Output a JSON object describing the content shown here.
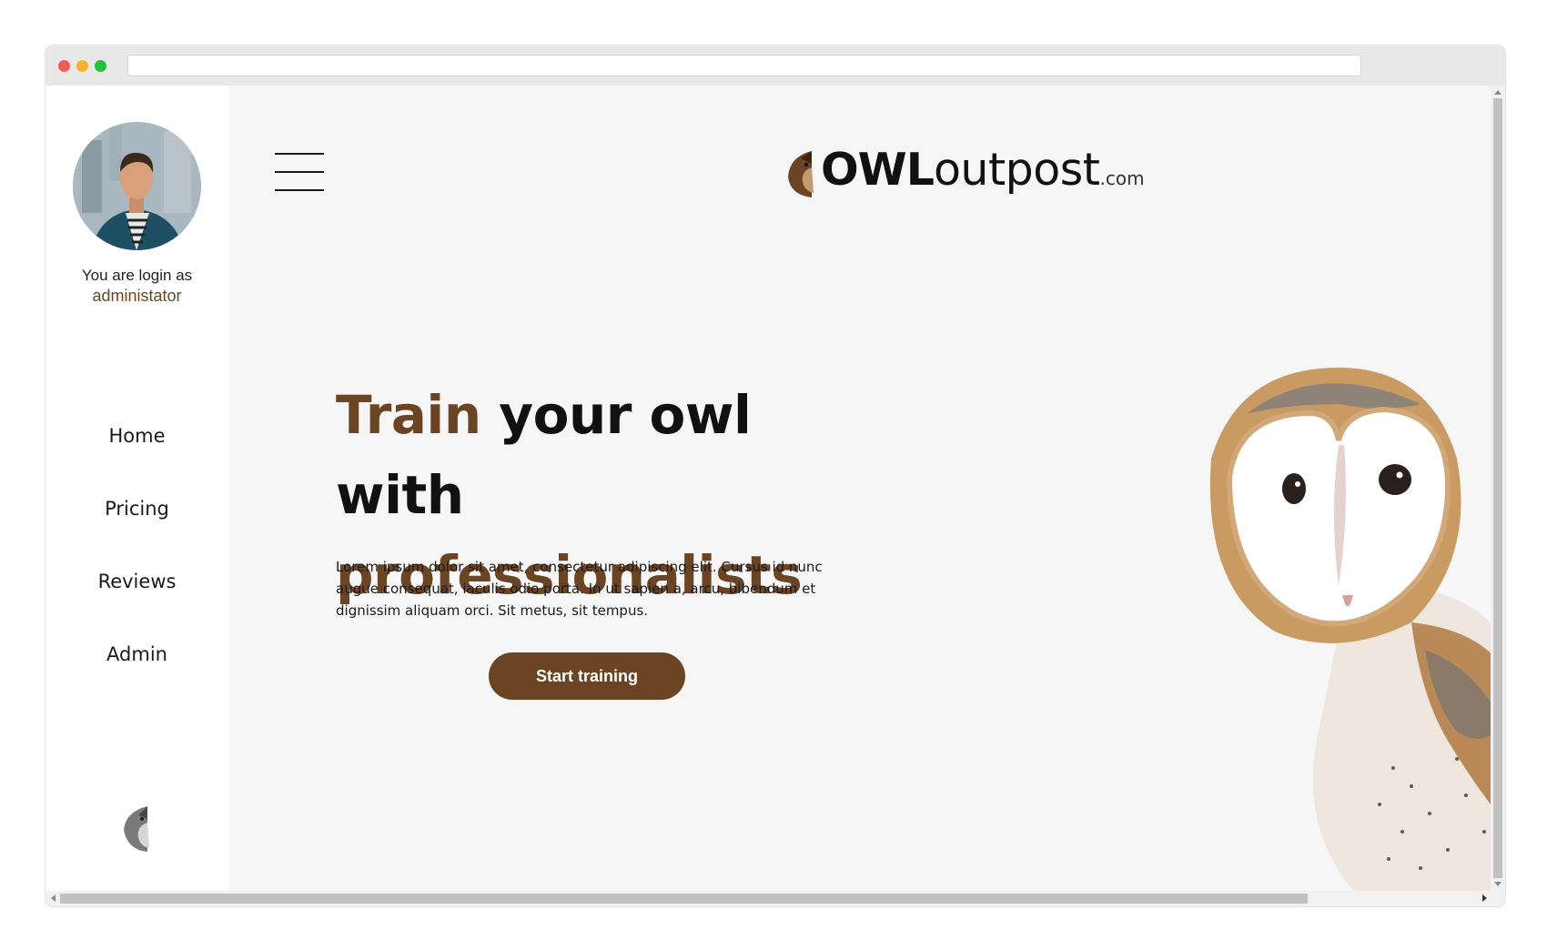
{
  "sidebar": {
    "login_line1": "You are login as",
    "login_role": "administator",
    "nav": [
      {
        "label": "Home"
      },
      {
        "label": "Pricing"
      },
      {
        "label": "Reviews"
      },
      {
        "label": "Admin"
      }
    ]
  },
  "header": {
    "brand_bold": "OWL",
    "brand_light": "outpost",
    "brand_tld": ".com"
  },
  "hero": {
    "line1_accent": "Train",
    "line1_rest": " your owl",
    "line2_start": "with ",
    "line2_accent": "professionalists",
    "body": "Lorem ipsum dolor sit amet, consectetur adipiscing elit. Cursus id nunc augue consequat, iaculis odio porta. In ut sapien a, arcu, bibendum et dignissim aliquam orci. Sit metus, sit tempus.",
    "cta_label": "Start training"
  },
  "colors": {
    "accent": "#6b4423",
    "background": "#f6f6f6",
    "sidebar": "#ffffff"
  },
  "icons": {
    "menu": "hamburger-icon",
    "brand": "owl-logo-icon"
  }
}
